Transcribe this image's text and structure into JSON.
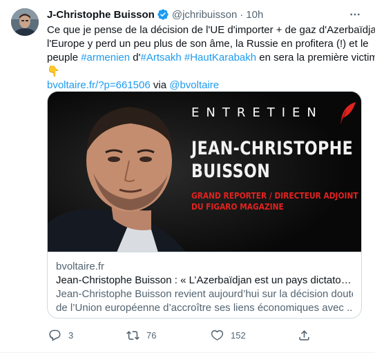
{
  "author": {
    "name": "J-Christophe Buisson",
    "handle": "@jchribuisson",
    "separator": "·",
    "time": "10h",
    "verified_icon": "verified-badge-icon"
  },
  "tweet": {
    "line1": "Ce que je pense de la décision de l'UE d'importer + de gaz d'Azerbaïdjan :",
    "line2": "l'Europe y perd un peu plus de son âme, la Russie en profitera (!) et le",
    "line3_start": "peuple ",
    "hashtag1": "#armenien",
    "line3_mid": " d'",
    "hashtag2": "#Artsakh",
    "line3_space": " ",
    "hashtag3": "#HautKarabakh",
    "line3_end": " en sera la première victime.",
    "emoji": "👇",
    "link": "bvoltaire.fr/?p=661506",
    "via": " via ",
    "mention": "@bvoltaire"
  },
  "card": {
    "image": {
      "heading": "ENTRETIEN",
      "name_line1": "JEAN-CHRISTOPHE",
      "name_line2": "BUISSON",
      "role_line1": "GRAND REPORTER / DIRECTEUR ADJOINT",
      "role_line2": "DU FIGARO MAGAZINE"
    },
    "domain": "bvoltaire.fr",
    "title": "Jean-Christophe Buisson : « L’Azerbaïdjan est un pays dictatorial et im...",
    "desc_line1": "Jean-Christophe Buisson revient aujourd’hui sur la décision douteuse",
    "desc_line2": "de l’Union européenne d’accroître ses liens économiques avec ..."
  },
  "actions": {
    "replies": "3",
    "retweets": "76",
    "likes": "152"
  },
  "colors": {
    "accent": "#1d9bf0",
    "secondary_text": "#536471",
    "image_red": "#e0231f"
  }
}
